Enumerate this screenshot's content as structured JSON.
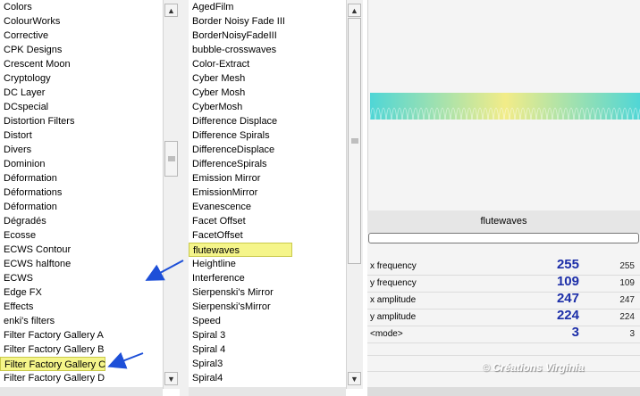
{
  "left_list": {
    "items": [
      "Colors",
      "ColourWorks",
      "Corrective",
      "CPK Designs",
      "Crescent Moon",
      "Cryptology",
      "DC Layer",
      "DCspecial",
      "Distortion Filters",
      "Distort",
      "Divers",
      "Dominion",
      "Déformation",
      "Déformations",
      "Déformation",
      "Dégradés",
      "Ecosse",
      "ECWS Contour",
      "ECWS halftone",
      "ECWS",
      "Edge FX",
      "Effects",
      "enki's filters",
      "Filter Factory Gallery A",
      "Filter Factory Gallery B",
      "Filter Factory Gallery C",
      "Filter Factory Gallery D"
    ],
    "selected_index": 25
  },
  "middle_list": {
    "items": [
      "AgedFilm",
      "Border Noisy Fade III",
      "BorderNoisyFadeIII",
      "bubble-crosswaves",
      "Color-Extract",
      "Cyber Mesh",
      "Cyber Mosh",
      "CyberMosh",
      "Difference Displace",
      "Difference Spirals",
      "DifferenceDisplace",
      "DifferenceSpirals",
      "Emission Mirror",
      "EmissionMirror",
      "Evanescence",
      "Facet Offset",
      "FacetOffset",
      "flutewaves",
      "Heightline",
      "Interference",
      "Sierpenski's Mirror",
      "Sierpenski'sMirror",
      "Speed",
      "Spiral 3",
      "Spiral 4",
      "Spiral3",
      "Spiral4"
    ],
    "selected_index": 17
  },
  "preview": {
    "filter_name": "flutewaves",
    "gradient_colors": [
      "#4fd6d6",
      "#f2ec88"
    ]
  },
  "params": [
    {
      "label": "x frequency",
      "value": "255",
      "small": "255"
    },
    {
      "label": "y frequency",
      "value": "109",
      "small": "109"
    },
    {
      "label": "x amplitude",
      "value": "247",
      "small": "247"
    },
    {
      "label": "y amplitude",
      "value": "224",
      "small": "224"
    },
    {
      "label": "<mode>",
      "value": "3",
      "small": "3"
    }
  ],
  "watermark": "© Créations Virginia",
  "colors": {
    "highlight": "#f5f58a",
    "arrow": "#1d4fd8",
    "param_value": "#1c2ea8"
  }
}
